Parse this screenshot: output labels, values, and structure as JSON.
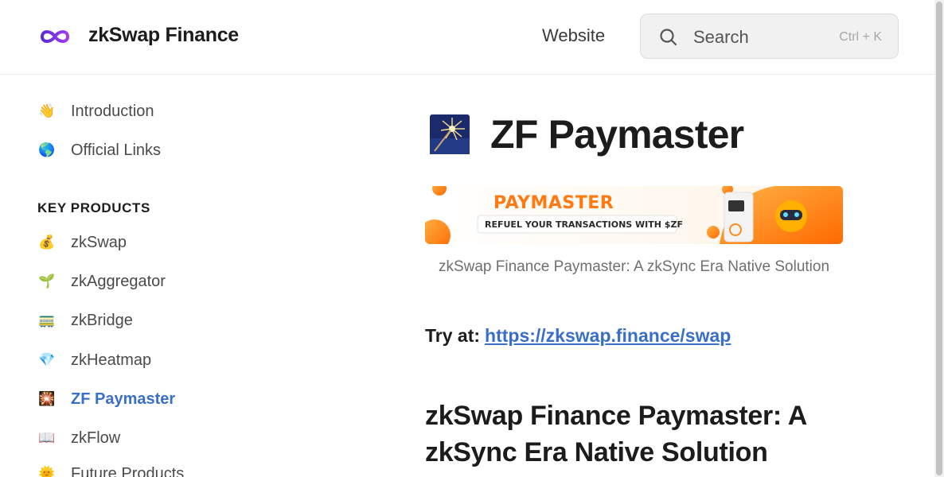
{
  "header": {
    "brand": "zkSwap Finance",
    "website_link": "Website",
    "search": {
      "placeholder": "Search",
      "shortcut": "Ctrl + K"
    }
  },
  "sidebar": {
    "items_top": [
      {
        "emoji": "👋",
        "label": "Introduction"
      },
      {
        "emoji": "🌎",
        "label": "Official Links"
      }
    ],
    "section_title": "KEY PRODUCTS",
    "items": [
      {
        "emoji": "💰",
        "label": "zkSwap"
      },
      {
        "emoji": "🌱",
        "label": "zkAggregator"
      },
      {
        "emoji": "🚃",
        "label": "zkBridge"
      },
      {
        "emoji": "💎",
        "label": "zkHeatmap"
      },
      {
        "emoji": "🎇",
        "label": "ZF Paymaster",
        "active": true
      },
      {
        "emoji": "📖",
        "label": "zkFlow"
      },
      {
        "emoji": "🌞",
        "label": "Future Products"
      }
    ]
  },
  "main": {
    "title": "ZF Paymaster",
    "banner": {
      "heading": "PAYMASTER",
      "subheading": "REFUEL YOUR TRANSACTIONS WITH $ZF"
    },
    "caption": "zkSwap Finance Paymaster: A zkSync Era Native Solution",
    "try_at_label": "Try at:",
    "try_at_link": "https://zkswap.finance/swap",
    "section_heading": "zkSwap Finance Paymaster: A zkSync Era Native Solution"
  },
  "colors": {
    "accent": "#3a6fc9",
    "brand_purple": "#7b2ff2",
    "banner_orange": "#ff8a1f"
  }
}
